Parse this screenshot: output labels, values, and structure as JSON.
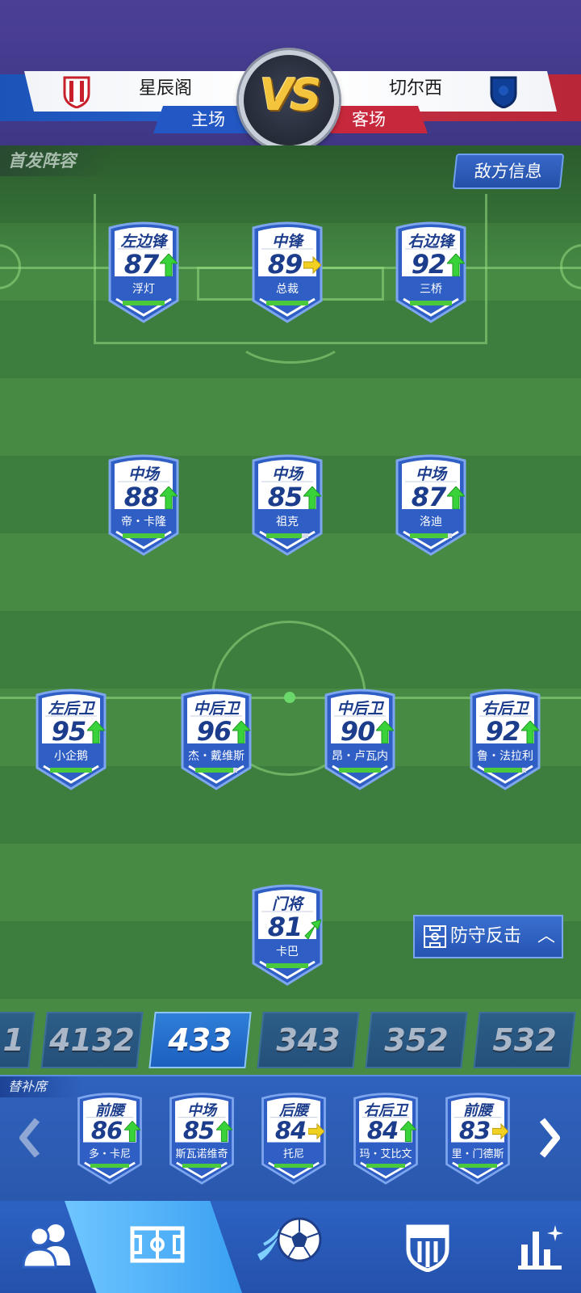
{
  "match": {
    "home_team": "星辰阁",
    "home_tag": "主场",
    "away_team": "切尔西",
    "away_tag": "客场",
    "vs_label": "VS"
  },
  "lineup": {
    "section_label": "首发阵容",
    "enemy_info_button": "敌方信息",
    "tactic_button": "防守反击",
    "players": [
      {
        "pos": "左边锋",
        "rating": "87",
        "name": "浮灯",
        "trend": "up",
        "stamina": 1.0
      },
      {
        "pos": "中锋",
        "rating": "89",
        "name": "总裁",
        "trend": "flat",
        "stamina": 1.0
      },
      {
        "pos": "右边锋",
        "rating": "92",
        "name": "三桥",
        "trend": "up",
        "stamina": 1.0
      },
      {
        "pos": "中场",
        "rating": "88",
        "name": "帝・卡隆",
        "trend": "up",
        "stamina": 1.0
      },
      {
        "pos": "中场",
        "rating": "85",
        "name": "祖克",
        "trend": "up",
        "stamina": 0.85
      },
      {
        "pos": "中场",
        "rating": "87",
        "name": "洛迪",
        "trend": "up",
        "stamina": 0.9
      },
      {
        "pos": "左后卫",
        "rating": "95",
        "name": "小企鹅",
        "trend": "up",
        "stamina": 1.0
      },
      {
        "pos": "中后卫",
        "rating": "96",
        "name": "杰・戴维斯",
        "trend": "up",
        "stamina": 0.9
      },
      {
        "pos": "中后卫",
        "rating": "90",
        "name": "昂・卢瓦内",
        "trend": "up",
        "stamina": 1.0
      },
      {
        "pos": "右后卫",
        "rating": "92",
        "name": "鲁・法拉利",
        "trend": "up",
        "stamina": 0.9
      },
      {
        "pos": "门将",
        "rating": "81",
        "name": "卡巴",
        "trend": "up-right",
        "stamina": 1.0
      }
    ]
  },
  "formations": [
    {
      "label": "1",
      "active": false
    },
    {
      "label": "4132",
      "active": false
    },
    {
      "label": "433",
      "active": true
    },
    {
      "label": "343",
      "active": false
    },
    {
      "label": "352",
      "active": false
    },
    {
      "label": "532",
      "active": false
    }
  ],
  "bench": {
    "label": "替补席",
    "players": [
      {
        "pos": "前腰",
        "rating": "86",
        "name": "多・卡尼",
        "trend": "up",
        "stamina": 1.0
      },
      {
        "pos": "中场",
        "rating": "85",
        "name": "斯瓦诺维奇",
        "trend": "up",
        "stamina": 1.0
      },
      {
        "pos": "后腰",
        "rating": "84",
        "name": "托尼",
        "trend": "flat",
        "stamina": 1.0
      },
      {
        "pos": "右后卫",
        "rating": "84",
        "name": "玛・艾比文",
        "trend": "up",
        "stamina": 1.0
      },
      {
        "pos": "前腰",
        "rating": "83",
        "name": "里・门德斯",
        "trend": "flat",
        "stamina": 1.0
      }
    ]
  },
  "nav": {
    "items": [
      "players-icon",
      "tactics-board-icon",
      "match-ball-icon",
      "club-crest-icon",
      "stats-icon"
    ],
    "active_index": 1
  },
  "colors": {
    "card_blue": "#2f5fc4",
    "card_text": "#1c3c8c",
    "arrow_up": "#3ad23a",
    "arrow_flat": "#f0d020",
    "stamina": "#49c93b"
  }
}
